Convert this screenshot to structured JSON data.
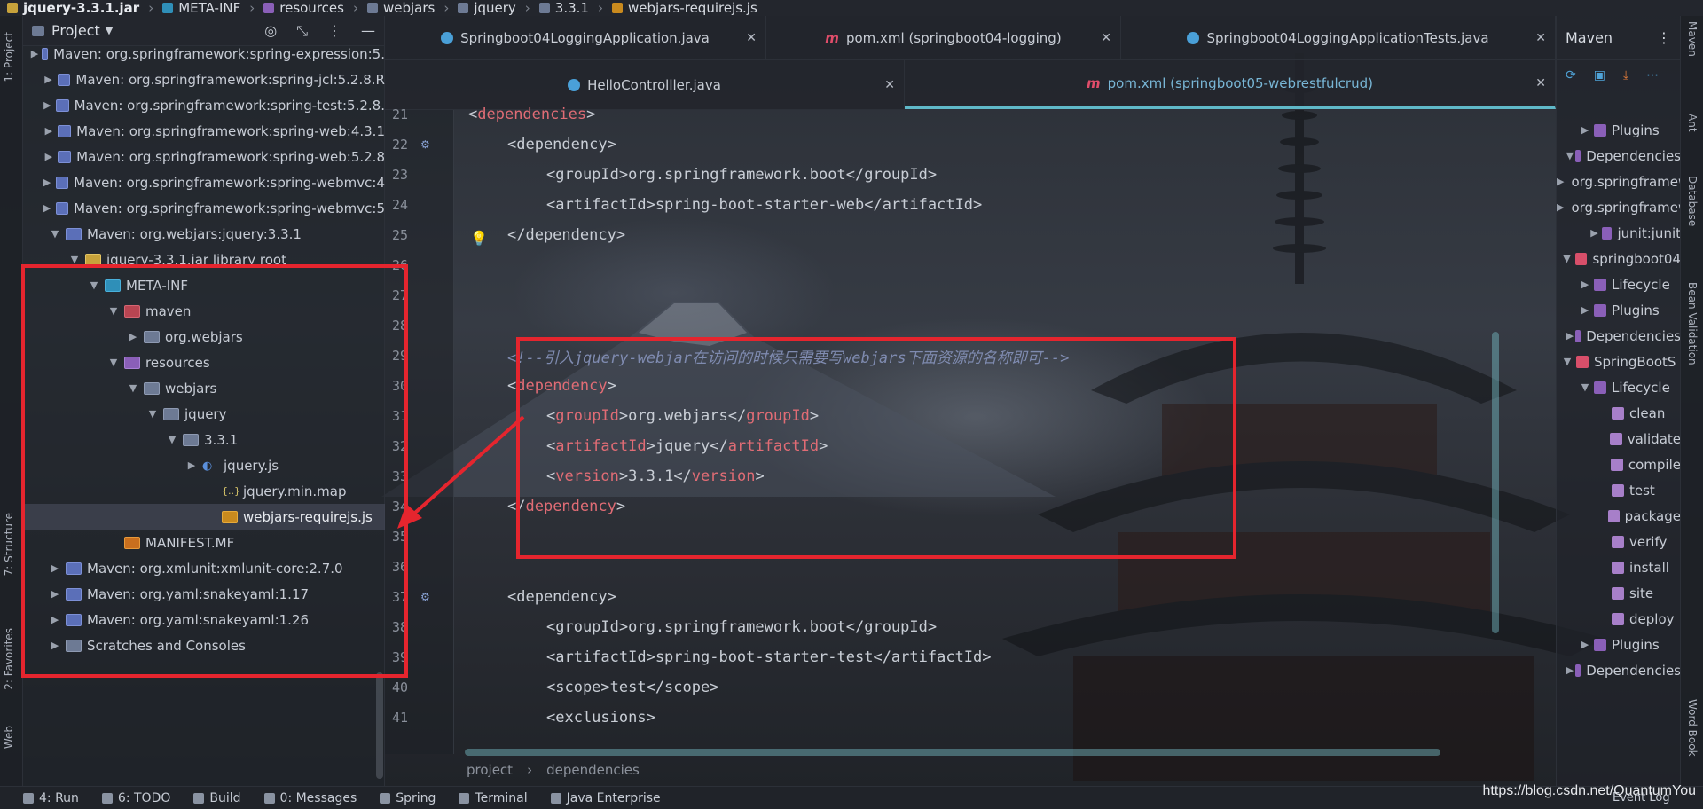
{
  "breadcrumb": [
    "jquery-3.3.1.jar",
    "META-INF",
    "resources",
    "webjars",
    "jquery",
    "3.3.1",
    "webjars-requirejs.js"
  ],
  "left_strip": {
    "project_label": "1: Project",
    "structure_label": "7: Structure",
    "favorites_label": "2: Favorites",
    "web_label": "Web"
  },
  "project_panel": {
    "title": "Project",
    "tree": [
      {
        "label": "Maven: org.springframework:spring-expression:5.",
        "indent": 0,
        "arrow": "right",
        "icon": "lib"
      },
      {
        "label": "Maven: org.springframework:spring-jcl:5.2.8.R",
        "indent": 0,
        "arrow": "right",
        "icon": "lib"
      },
      {
        "label": "Maven: org.springframework:spring-test:5.2.8.",
        "indent": 0,
        "arrow": "right",
        "icon": "lib"
      },
      {
        "label": "Maven: org.springframework:spring-web:4.3.1",
        "indent": 0,
        "arrow": "right",
        "icon": "lib"
      },
      {
        "label": "Maven: org.springframework:spring-web:5.2.8",
        "indent": 0,
        "arrow": "right",
        "icon": "lib"
      },
      {
        "label": "Maven: org.springframework:spring-webmvc:4",
        "indent": 0,
        "arrow": "right",
        "icon": "lib"
      },
      {
        "label": "Maven: org.springframework:spring-webmvc:5",
        "indent": 0,
        "arrow": "right",
        "icon": "lib"
      },
      {
        "label": "Maven: org.webjars:jquery:3.3.1",
        "indent": 0,
        "arrow": "down",
        "icon": "lib"
      },
      {
        "label": "jquery-3.3.1.jar  library root",
        "indent": 1,
        "arrow": "down",
        "icon": "jar"
      },
      {
        "label": "META-INF",
        "indent": 2,
        "arrow": "down",
        "icon": "folder-src"
      },
      {
        "label": "maven",
        "indent": 3,
        "arrow": "down",
        "icon": "folder-mvn"
      },
      {
        "label": "org.webjars",
        "indent": 4,
        "arrow": "right",
        "icon": "folder"
      },
      {
        "label": "resources",
        "indent": 3,
        "arrow": "down",
        "icon": "folder-res"
      },
      {
        "label": "webjars",
        "indent": 4,
        "arrow": "down",
        "icon": "folder"
      },
      {
        "label": "jquery",
        "indent": 5,
        "arrow": "down",
        "icon": "folder"
      },
      {
        "label": "3.3.1",
        "indent": 6,
        "arrow": "down",
        "icon": "folder"
      },
      {
        "label": "jquery.js",
        "indent": 7,
        "arrow": "right",
        "icon": "jq"
      },
      {
        "label": "jquery.min.map",
        "indent": 8,
        "arrow": "",
        "icon": "map"
      },
      {
        "label": "webjars-requirejs.js",
        "indent": 8,
        "arrow": "",
        "icon": "js",
        "selected": true
      },
      {
        "label": "MANIFEST.MF",
        "indent": 3,
        "arrow": "",
        "icon": "mf"
      },
      {
        "label": "Maven: org.xmlunit:xmlunit-core:2.7.0",
        "indent": 0,
        "arrow": "right",
        "icon": "lib"
      },
      {
        "label": "Maven: org.yaml:snakeyaml:1.17",
        "indent": 0,
        "arrow": "right",
        "icon": "lib"
      },
      {
        "label": "Maven: org.yaml:snakeyaml:1.26",
        "indent": 0,
        "arrow": "right",
        "icon": "lib"
      },
      {
        "label": "Scratches and Consoles",
        "indent": 0,
        "arrow": "right",
        "icon": "folder"
      }
    ]
  },
  "tabs_row1": [
    {
      "label": "Springboot04LoggingApplication.java",
      "icon": "java"
    },
    {
      "label": "pom.xml (springboot04-logging)",
      "icon": "maven"
    },
    {
      "label": "Springboot04LoggingApplicationTests.java",
      "icon": "java"
    }
  ],
  "tabs_row2": [
    {
      "label": "HelloControlller.java",
      "icon": "java",
      "active": false
    },
    {
      "label": "pom.xml (springboot05-webrestfulcrud)",
      "icon": "maven",
      "active": true
    }
  ],
  "editor": {
    "lines": [
      {
        "n": "21",
        "parts": [
          [
            "tag",
            "<"
          ],
          [
            "tag-red",
            "dependencies"
          ],
          [
            "tag",
            ">"
          ]
        ],
        "indent": 0
      },
      {
        "n": "22",
        "parts": [
          [
            "tag",
            "<dependency>"
          ]
        ],
        "indent": 1
      },
      {
        "n": "23",
        "parts": [
          [
            "tag",
            "<groupId>org.springframework.boot</groupId>"
          ]
        ],
        "indent": 2
      },
      {
        "n": "24",
        "parts": [
          [
            "tag",
            "<artifactId>spring-boot-starter-web</artifactId>"
          ]
        ],
        "indent": 2
      },
      {
        "n": "25",
        "parts": [
          [
            "tag",
            "</dependency>"
          ]
        ],
        "indent": 1
      },
      {
        "n": "26",
        "parts": [],
        "indent": 0
      },
      {
        "n": "27",
        "parts": [],
        "indent": 0
      },
      {
        "n": "28",
        "parts": [],
        "indent": 0
      },
      {
        "n": "29",
        "parts": [
          [
            "cmt",
            "<!--引入jquery-webjar在访问的时候只需要写webjars下面资源的名称即可-->"
          ]
        ],
        "indent": 1
      },
      {
        "n": "30",
        "parts": [
          [
            "tag",
            "<"
          ],
          [
            "tag-red",
            "dependency"
          ],
          [
            "tag",
            ">"
          ]
        ],
        "indent": 1
      },
      {
        "n": "31",
        "parts": [
          [
            "tag",
            "<"
          ],
          [
            "tag-red",
            "groupId"
          ],
          [
            "tag",
            ">org.webjars</"
          ],
          [
            "tag-red",
            "groupId"
          ],
          [
            "tag",
            ">"
          ]
        ],
        "indent": 2
      },
      {
        "n": "32",
        "parts": [
          [
            "tag",
            "<"
          ],
          [
            "tag-red",
            "artifactId"
          ],
          [
            "tag",
            ">jquery</"
          ],
          [
            "tag-red",
            "artifactId"
          ],
          [
            "tag",
            ">"
          ]
        ],
        "indent": 2
      },
      {
        "n": "33",
        "parts": [
          [
            "tag",
            "<"
          ],
          [
            "tag-red",
            "version"
          ],
          [
            "tag",
            ">3.3.1</"
          ],
          [
            "tag-red",
            "version"
          ],
          [
            "tag",
            ">"
          ]
        ],
        "indent": 2
      },
      {
        "n": "34",
        "parts": [
          [
            "tag",
            "</"
          ],
          [
            "tag-red",
            "dependency"
          ],
          [
            "tag",
            ">"
          ]
        ],
        "indent": 1
      },
      {
        "n": "35",
        "parts": [],
        "indent": 0
      },
      {
        "n": "36",
        "parts": [],
        "indent": 0
      },
      {
        "n": "37",
        "parts": [
          [
            "tag",
            "<dependency>"
          ]
        ],
        "indent": 1
      },
      {
        "n": "38",
        "parts": [
          [
            "tag",
            "<groupId>org.springframework.boot</groupId>"
          ]
        ],
        "indent": 2
      },
      {
        "n": "39",
        "parts": [
          [
            "tag",
            "<artifactId>spring-boot-starter-test</artifactId>"
          ]
        ],
        "indent": 2
      },
      {
        "n": "40",
        "parts": [
          [
            "tag",
            "<scope>test</scope>"
          ]
        ],
        "indent": 2
      },
      {
        "n": "41",
        "parts": [
          [
            "tag",
            "<exclusions>"
          ]
        ],
        "indent": 2
      }
    ],
    "breadcrumb": [
      "project",
      "dependencies"
    ]
  },
  "maven_panel": {
    "title": "Maven",
    "rows": [
      {
        "label": "Plugins",
        "indent": 1,
        "arrow": "right",
        "icon": "folder"
      },
      {
        "label": "Dependencies",
        "indent": 1,
        "arrow": "down",
        "icon": "folder"
      },
      {
        "label": "org.springframework",
        "indent": 2,
        "arrow": "right",
        "icon": "dep"
      },
      {
        "label": "org.springframework",
        "indent": 2,
        "arrow": "right",
        "icon": "dep"
      },
      {
        "label": "junit:junit",
        "indent": 2,
        "arrow": "right",
        "icon": "dep"
      },
      {
        "label": "springboot04",
        "indent": 0,
        "arrow": "down",
        "icon": "proj"
      },
      {
        "label": "Lifecycle",
        "indent": 1,
        "arrow": "right",
        "icon": "folder"
      },
      {
        "label": "Plugins",
        "indent": 1,
        "arrow": "right",
        "icon": "folder"
      },
      {
        "label": "Dependencies",
        "indent": 1,
        "arrow": "right",
        "icon": "folder"
      },
      {
        "label": "SpringBootS",
        "indent": 0,
        "arrow": "down",
        "icon": "proj"
      },
      {
        "label": "Lifecycle",
        "indent": 1,
        "arrow": "down",
        "icon": "folder"
      },
      {
        "label": "clean",
        "indent": 2,
        "arrow": "",
        "icon": "goal"
      },
      {
        "label": "validate",
        "indent": 2,
        "arrow": "",
        "icon": "goal"
      },
      {
        "label": "compile",
        "indent": 2,
        "arrow": "",
        "icon": "goal"
      },
      {
        "label": "test",
        "indent": 2,
        "arrow": "",
        "icon": "goal"
      },
      {
        "label": "package",
        "indent": 2,
        "arrow": "",
        "icon": "goal"
      },
      {
        "label": "verify",
        "indent": 2,
        "arrow": "",
        "icon": "goal"
      },
      {
        "label": "install",
        "indent": 2,
        "arrow": "",
        "icon": "goal"
      },
      {
        "label": "site",
        "indent": 2,
        "arrow": "",
        "icon": "goal"
      },
      {
        "label": "deploy",
        "indent": 2,
        "arrow": "",
        "icon": "goal"
      },
      {
        "label": "Plugins",
        "indent": 1,
        "arrow": "right",
        "icon": "folder"
      },
      {
        "label": "Dependencies",
        "indent": 1,
        "arrow": "right",
        "icon": "folder"
      }
    ]
  },
  "right_strip": {
    "maven_label": "Maven",
    "ant_label": "Ant",
    "database_label": "Database",
    "bean_label": "Bean Validation",
    "word_label": "Word Book"
  },
  "statusbar": {
    "items": [
      "4: Run",
      "6: TODO",
      "Build",
      "0: Messages",
      "Spring",
      "Terminal",
      "Java Enterprise"
    ],
    "event_log": "Event Log"
  },
  "watermark": "https://blog.csdn.net/QuantumYou",
  "colors": {
    "annotation_red": "#e5252e",
    "xml_tag_red": "#e06c75",
    "comment": "#7f8bb0",
    "active_tab_underline": "#5fb8c8"
  }
}
